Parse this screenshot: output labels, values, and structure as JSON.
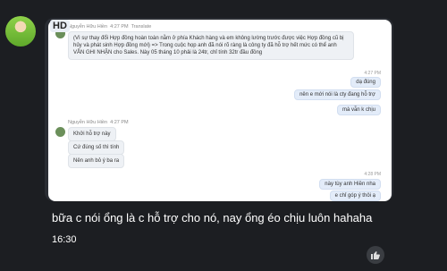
{
  "hd_badge": "HD",
  "msg1": {
    "sender": "Nguyễn Hữu Hiền",
    "time": "4:27 PM",
    "status": "Translate",
    "text": "(Vì sự thay đổi Hợp đồng hoàn toàn nằm ở phía Khách hàng và em không lường trước được việc Hợp đồng cũ bị hủy và phát sinh Hợp đồng mới) => Trong cuộc họp anh đã nói rõ ràng là công ty đã hỗ trợ hết mức có thể anh VẪN GHI NHẬN cho Sales. Này 05 tháng 10 phải là 24tr, chỉ tính 32tr đầu đồng"
  },
  "out1": {
    "time": "4:27 PM",
    "lines": [
      "dạ đúng",
      "nên e mới nói là cty đang hỗ trợ",
      "mà vẫn k chịu"
    ]
  },
  "msg2": {
    "sender": "Nguyễn Hữu Hiền",
    "time": "4:27 PM",
    "lines": [
      "Khởi hỗ trợ này",
      "Cứ đúng số thì tính",
      "Nên anh bỏ ý ba ra"
    ]
  },
  "out2": {
    "time": "4:28 PM",
    "lines": [
      "này tùy anh Hiền nha",
      "e chỉ góp ý thôi ạ"
    ]
  },
  "caption": "bữa c nói ổng là c hỗ trợ cho nó, nay ổng éo chịu luôn hahaha",
  "timestamp": "16:30",
  "colors": {
    "background": "#1c1e22",
    "bubble": "#2a2d33",
    "text": "#ffffff"
  },
  "icons": {
    "like": "thumbs-up-icon"
  }
}
